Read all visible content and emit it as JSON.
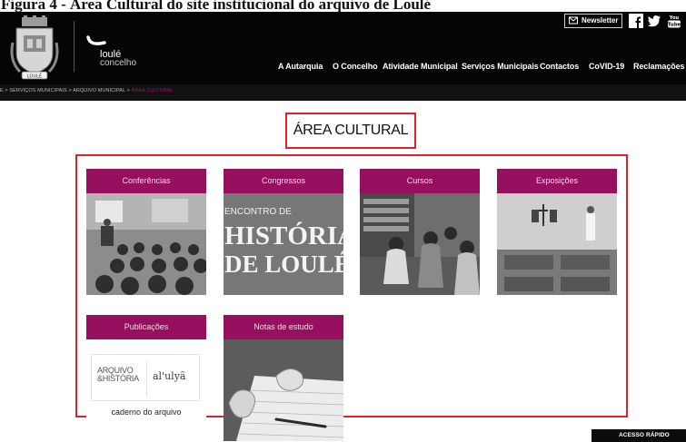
{
  "caption": "Figura 4 - Área Cultural do site institucional do arquivo de Loulé",
  "logo": {
    "name": "loulé",
    "sub": "concelho",
    "crest_ribbon": "LOULÉ"
  },
  "header": {
    "newsletter_label": "Newsletter",
    "social": [
      "facebook-icon",
      "twitter-icon",
      "youtube-icon"
    ]
  },
  "nav": [
    "A Autarquia",
    "O Concelho",
    "Atividade Municipal",
    "Serviços Municipais",
    "Contactos",
    "CoVID-19",
    "Reclamações"
  ],
  "breadcrumb": {
    "items": [
      "E",
      "SERVIÇOS MUNICIPAIS",
      "ARQUIVO MUNICIPAL"
    ],
    "separator": ">",
    "current": "ÁREA CULTURAL"
  },
  "page_title": "ÁREA CULTURAL",
  "tiles": [
    {
      "label": "Conferências",
      "image": "conference-photo"
    },
    {
      "label": "Congressos",
      "image": "poster",
      "poster": [
        "ENCONTRO DE",
        "HISTÓRIA",
        "DE LOULÉ"
      ]
    },
    {
      "label": "Cursos",
      "image": "course-photo"
    },
    {
      "label": "Exposições",
      "image": "exhibition-photo"
    },
    {
      "label": "Publicações",
      "image": "publications-card",
      "card_left": [
        "ARQUIVO",
        "&",
        "HISTÓRIA"
      ],
      "card_right": "al'ulyã",
      "card_caption": "caderno do arquivo"
    },
    {
      "label": "Notas de estudo",
      "image": "notebook-photo"
    }
  ],
  "quick_access": "ACESSO RÁPIDO",
  "colors": {
    "header_bg": "#050505",
    "tile_head": "#96105f",
    "highlight_border": "#e0202a",
    "breadcrumb_active": "#a8146c"
  }
}
